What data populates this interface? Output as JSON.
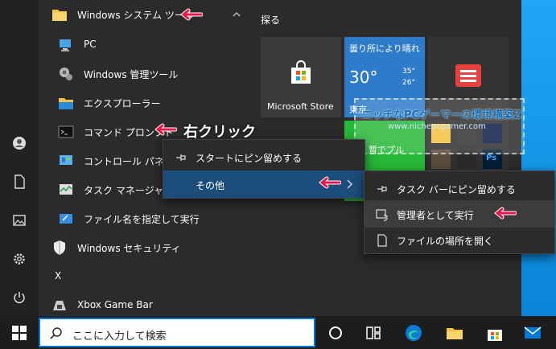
{
  "applist": {
    "group_label": "Windows システム ツール",
    "items": [
      {
        "label": "PC",
        "icon": "pc-icon"
      },
      {
        "label": "Windows 管理ツール",
        "icon": "admin-tools-icon"
      },
      {
        "label": "エクスプローラー",
        "icon": "folder-icon"
      },
      {
        "label": "コマンド プロンプト",
        "icon": "cmd-icon"
      },
      {
        "label": "コントロール パネル",
        "icon": "control-panel-icon"
      },
      {
        "label": "タスク マネージャー",
        "icon": "task-manager-icon"
      },
      {
        "label": "ファイル名を指定して実行",
        "icon": "run-icon"
      }
    ],
    "security_label": "Windows セキュリティ",
    "letter_x": "X",
    "xbox_label": "Xbox Game Bar"
  },
  "tiles": {
    "header": "探る",
    "store_label": "Microsoft Store",
    "weather_desc": "曇り所により晴れ",
    "weather_temp": "30°",
    "weather_hi": "35°",
    "weather_lo": "26°",
    "weather_city": "東京",
    "partial_label": "暫でプル"
  },
  "watermark": {
    "line1": "ニッチなPCゲーマーの環境構築Z",
    "line2": "www.nichepcgamer.com"
  },
  "context_menu_1": {
    "items": [
      {
        "label": "スタートにピン留めする"
      },
      {
        "label": "その他"
      }
    ]
  },
  "context_menu_2": {
    "items": [
      {
        "label": "タスク バーにピン留めする"
      },
      {
        "label": "管理者として実行"
      },
      {
        "label": "ファイルの場所を開く"
      }
    ]
  },
  "annotation": {
    "right_click": "右クリック"
  },
  "taskbar": {
    "search_placeholder": "ここに入力して検索"
  },
  "colors": {
    "accent": "#0078d7",
    "arrow_red": "#e8174a",
    "menu_highlight": "#1b4d7a"
  }
}
